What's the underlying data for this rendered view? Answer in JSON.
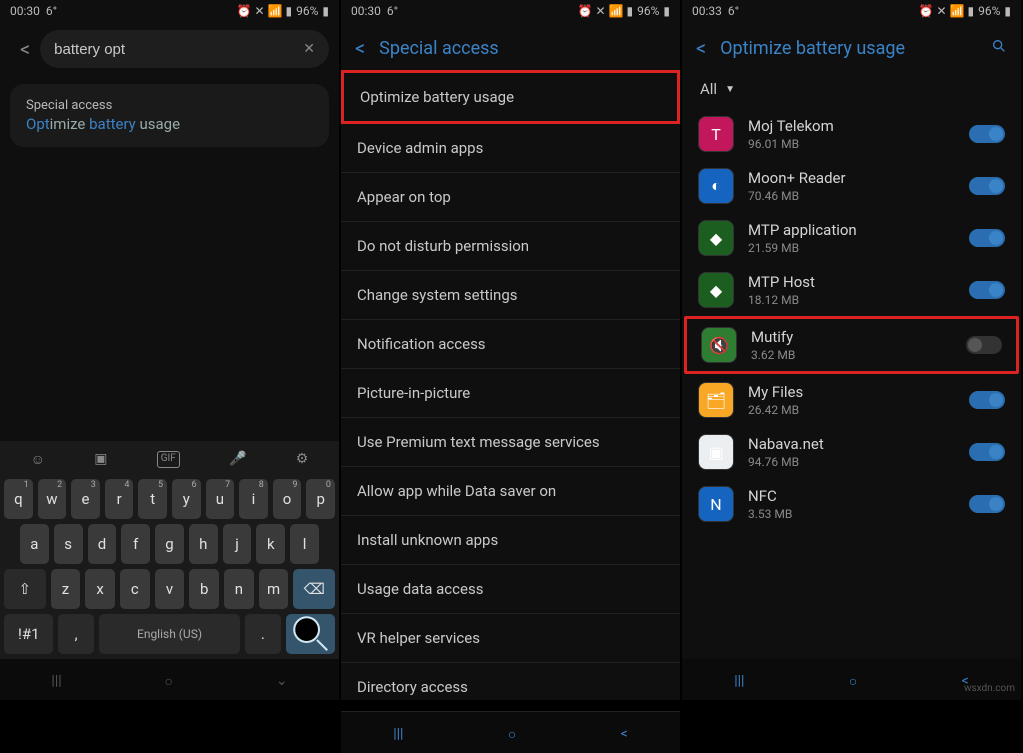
{
  "status": {
    "time1": "00:30",
    "time2": "00:30",
    "time3": "00:33",
    "temp": "6°",
    "battery": "96%"
  },
  "screen1": {
    "search_value": "battery opt",
    "result_title": "Special access",
    "result_parts": {
      "opt": "Opt",
      "imize": "imize ",
      "battery": "battery",
      "usage": " usage"
    },
    "keyboard_lang": "English (US)",
    "sym_key": "!#1"
  },
  "screen2": {
    "title": "Special access",
    "items": [
      "Optimize battery usage",
      "Device admin apps",
      "Appear on top",
      "Do not disturb permission",
      "Change system settings",
      "Notification access",
      "Picture-in-picture",
      "Use Premium text message services",
      "Allow app while Data saver on",
      "Install unknown apps",
      "Usage data access",
      "VR helper services",
      "Directory access"
    ]
  },
  "screen3": {
    "title": "Optimize battery usage",
    "filter": "All",
    "apps": [
      {
        "name": "Moj Telekom",
        "size": "96.01 MB",
        "on": true,
        "bg": "#c2185b",
        "ic": "T"
      },
      {
        "name": "Moon+ Reader",
        "size": "70.46 MB",
        "on": true,
        "bg": "#1565c0",
        "ic": "◐"
      },
      {
        "name": "MTP application",
        "size": "21.59 MB",
        "on": true,
        "bg": "#1b5e20",
        "ic": "◆"
      },
      {
        "name": "MTP Host",
        "size": "18.12 MB",
        "on": true,
        "bg": "#1b5e20",
        "ic": "◆"
      },
      {
        "name": "Mutify",
        "size": "3.62 MB",
        "on": false,
        "bg": "#2e7d32",
        "ic": "🔇",
        "hl": true
      },
      {
        "name": "My Files",
        "size": "26.42 MB",
        "on": true,
        "bg": "#f9a825",
        "ic": "🗂"
      },
      {
        "name": "Nabava.net",
        "size": "94.76 MB",
        "on": true,
        "bg": "#eceff1",
        "ic": "▣"
      },
      {
        "name": "NFC",
        "size": "3.53 MB",
        "on": true,
        "bg": "#1565c0",
        "ic": "N"
      }
    ]
  },
  "watermark": "wsxdn.com"
}
